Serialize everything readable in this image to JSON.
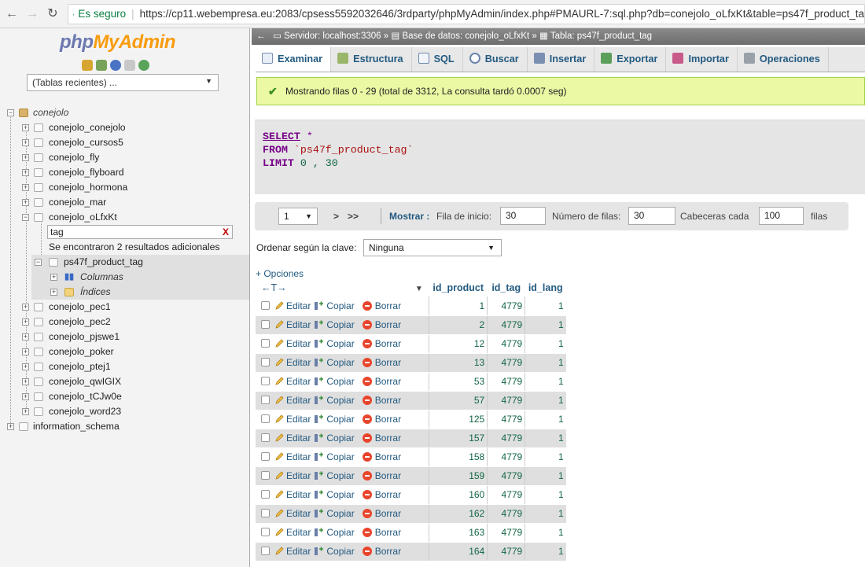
{
  "browser": {
    "secure_label": "Es seguro",
    "url": "https://cp11.webempresa.eu:2083/cpsess5592032646/3rdparty/phpMyAdmin/index.php#PMAURL-7:sql.php?db=conejolo_oLfxKt&table=ps47f_product_ta"
  },
  "nav": {
    "logo_php": "php",
    "logo_mya": "MyAdmin",
    "recent": "(Tablas recientes) ...",
    "root_db": "conejolo",
    "dbs_before": [
      "conejolo_conejolo",
      "conejolo_cursos5",
      "conejolo_fly",
      "conejolo_flyboard",
      "conejolo_hormona",
      "conejolo_mar",
      "conejolo_oLfxKt"
    ],
    "filter_value": "tag",
    "filter_clear": "X",
    "filter_msg": "Se encontraron 2 resultados adicionales",
    "table_name": "ps47f_product_tag",
    "columns_label": "Columnas",
    "indexes_label": "Índices",
    "dbs_after": [
      "conejolo_pec1",
      "conejolo_pec2",
      "conejolo_pjswe1",
      "conejolo_poker",
      "conejolo_ptej1",
      "conejolo_qwIGIX",
      "conejolo_tCJw0e",
      "conejolo_word23"
    ],
    "schema": "information_schema"
  },
  "breadcrumb": {
    "server": "Servidor: localhost:3306",
    "database": "Base de datos: conejolo_oLfxKt",
    "table": "Tabla: ps47f_product_tag",
    "sep": "»",
    "back": "←"
  },
  "tabs": [
    "Examinar",
    "Estructura",
    "SQL",
    "Buscar",
    "Insertar",
    "Exportar",
    "Importar",
    "Operaciones"
  ],
  "message": "Mostrando filas 0 - 29 (total de 3312, La consulta tardó 0.0007 seg)",
  "sql": {
    "select": "SELECT",
    "star": "*",
    "from": "FROM",
    "table": "`ps47f_product_tag`",
    "limit": "LIMIT",
    "limit_vals": "0 , 30"
  },
  "pager": {
    "page": "1",
    "next": ">",
    "last": ">>",
    "show_label": "Mostrar :",
    "start_label": "Fila de inicio:",
    "start_value": "30",
    "rows_label": "Número de filas:",
    "rows_value": "30",
    "headers_label": "Cabeceras cada",
    "headers_value": "100",
    "rows_suffix": "filas"
  },
  "order": {
    "label": "Ordenar según la clave:",
    "value": "Ninguna"
  },
  "options_link": "+ Opciones",
  "col_arrows": "←T→",
  "table": {
    "columns": [
      "id_product",
      "id_tag",
      "id_lang"
    ],
    "actions": {
      "edit": "Editar",
      "copy": "Copiar",
      "delete": "Borrar"
    },
    "rows": [
      [
        "1",
        "4779",
        "1"
      ],
      [
        "2",
        "4779",
        "1"
      ],
      [
        "12",
        "4779",
        "1"
      ],
      [
        "13",
        "4779",
        "1"
      ],
      [
        "53",
        "4779",
        "1"
      ],
      [
        "57",
        "4779",
        "1"
      ],
      [
        "125",
        "4779",
        "1"
      ],
      [
        "157",
        "4779",
        "1"
      ],
      [
        "158",
        "4779",
        "1"
      ],
      [
        "159",
        "4779",
        "1"
      ],
      [
        "160",
        "4779",
        "1"
      ],
      [
        "162",
        "4779",
        "1"
      ],
      [
        "163",
        "4779",
        "1"
      ],
      [
        "164",
        "4779",
        "1"
      ]
    ]
  },
  "colors": {
    "link": "#235a81",
    "message_bg": "#ebf8a4",
    "logo_blue": "#6c78af",
    "logo_orange": "#f89c0e"
  }
}
